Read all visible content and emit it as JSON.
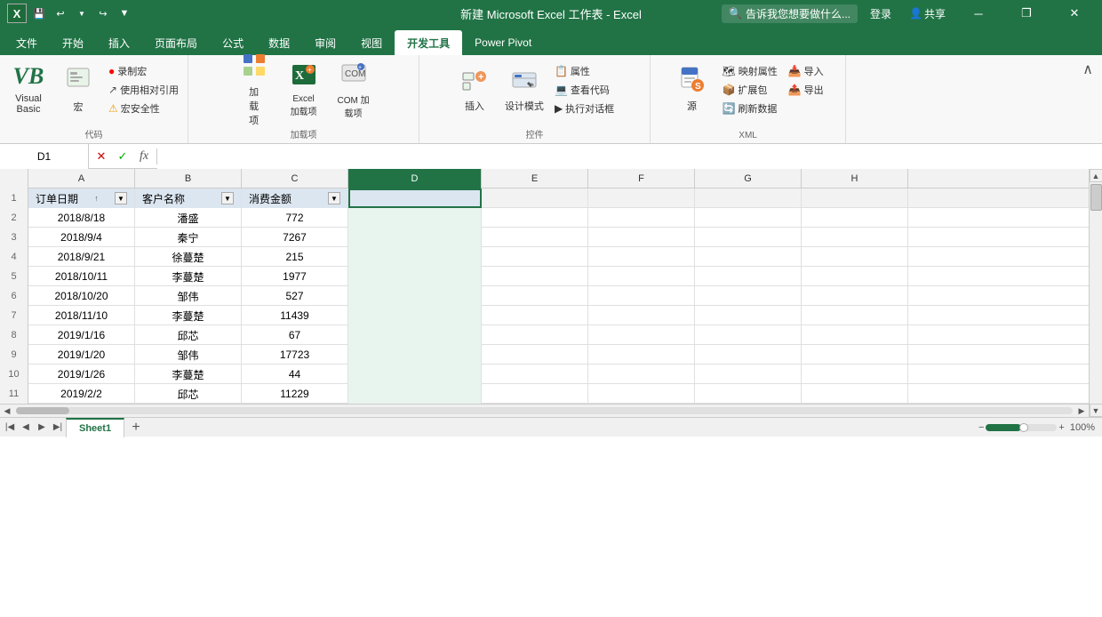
{
  "titleBar": {
    "title": "新建 Microsoft Excel 工作表 - Excel",
    "quickSave": "💾",
    "undo": "↩",
    "redo": "↪",
    "filter": "▼",
    "minimize": "─",
    "maximize": "□",
    "restore": "❐",
    "close": "✕",
    "login": "登录",
    "share": "共享"
  },
  "tabs": [
    {
      "label": "文件",
      "active": false
    },
    {
      "label": "开始",
      "active": false
    },
    {
      "label": "插入",
      "active": false
    },
    {
      "label": "页面布局",
      "active": false
    },
    {
      "label": "公式",
      "active": false
    },
    {
      "label": "数据",
      "active": false
    },
    {
      "label": "审阅",
      "active": false
    },
    {
      "label": "视图",
      "active": false
    },
    {
      "label": "开发工具",
      "active": true
    },
    {
      "label": "Power Pivot",
      "active": false
    }
  ],
  "ribbon": {
    "groups": [
      {
        "id": "code",
        "label": "代码",
        "items": [
          {
            "type": "large",
            "icon": "VB",
            "label": "Visual Basic"
          },
          {
            "type": "large",
            "icon": "M",
            "label": "宏"
          },
          {
            "type": "small",
            "icon": "⏺",
            "label": "录制宏"
          },
          {
            "type": "small",
            "icon": "↗",
            "label": "使用相对引用"
          },
          {
            "type": "small",
            "icon": "⚠",
            "label": "宏安全性"
          }
        ]
      },
      {
        "id": "addins",
        "label": "加载项",
        "items": [
          {
            "type": "large",
            "icon": "➕",
            "label": "加载项"
          },
          {
            "type": "large",
            "icon": "XL",
            "label": "Excel 加载项"
          },
          {
            "type": "large",
            "icon": "COM",
            "label": "COM 加载项"
          }
        ]
      },
      {
        "id": "controls",
        "label": "控件",
        "items": [
          {
            "type": "large",
            "icon": "🔧",
            "label": "插入"
          },
          {
            "type": "large",
            "icon": "✏",
            "label": "设计模式"
          },
          {
            "type": "small",
            "icon": "📋",
            "label": "属性"
          },
          {
            "type": "small",
            "icon": "💻",
            "label": "查看代码"
          },
          {
            "type": "small",
            "icon": "▶",
            "label": "执行对话框"
          }
        ]
      },
      {
        "id": "xml",
        "label": "XML",
        "items": [
          {
            "type": "large",
            "icon": "📄",
            "label": "源"
          },
          {
            "type": "small",
            "icon": "🗺",
            "label": "映射属性"
          },
          {
            "type": "small",
            "icon": "📦",
            "label": "扩展包"
          },
          {
            "type": "small",
            "icon": "🔄",
            "label": "刷新数据"
          },
          {
            "type": "small",
            "icon": "📥",
            "label": "导入"
          },
          {
            "type": "small",
            "icon": "📤",
            "label": "导出"
          }
        ]
      }
    ]
  },
  "formulaBar": {
    "nameBox": "D1",
    "cancelIcon": "✕",
    "confirmIcon": "✓",
    "functionIcon": "fx"
  },
  "columns": [
    {
      "id": "row-num",
      "label": "",
      "class": "row-num-header"
    },
    {
      "id": "A",
      "label": "A",
      "class": "col-a"
    },
    {
      "id": "B",
      "label": "B",
      "class": "col-b"
    },
    {
      "id": "C",
      "label": "C",
      "class": "col-c"
    },
    {
      "id": "D",
      "label": "D",
      "class": "col-d"
    },
    {
      "id": "E",
      "label": "E",
      "class": "col-e"
    },
    {
      "id": "F",
      "label": "F",
      "class": "col-f"
    },
    {
      "id": "G",
      "label": "G",
      "class": "col-g"
    },
    {
      "id": "H",
      "label": "H",
      "class": "col-h"
    }
  ],
  "headerRow": {
    "col_a": "订单日期",
    "col_a_icon": "↑",
    "col_b": "客户名称",
    "col_c": "消费金额",
    "hasFilterA": true,
    "hasFilterB": true,
    "hasFilterC": true
  },
  "rows": [
    {
      "num": 2,
      "a": "2018/8/18",
      "b": "潘盛",
      "c": "772"
    },
    {
      "num": 3,
      "a": "2018/9/4",
      "b": "秦宁",
      "c": "7267"
    },
    {
      "num": 4,
      "a": "2018/9/21",
      "b": "徐蔓楚",
      "c": "215"
    },
    {
      "num": 5,
      "a": "2018/10/11",
      "b": "李蔓楚",
      "c": "1977"
    },
    {
      "num": 6,
      "a": "2018/10/20",
      "b": "邹伟",
      "c": "527"
    },
    {
      "num": 7,
      "a": "2018/11/10",
      "b": "李蔓楚",
      "c": "11439"
    },
    {
      "num": 8,
      "a": "2019/1/16",
      "b": "邱芯",
      "c": "67"
    },
    {
      "num": 9,
      "a": "2019/1/20",
      "b": "邹伟",
      "c": "17723"
    },
    {
      "num": 10,
      "a": "2019/1/26",
      "b": "李蔓楚",
      "c": "44"
    },
    {
      "num": 11,
      "a": "2019/2/2",
      "b": "邱芯",
      "c": "11229"
    }
  ],
  "sheetTabs": [
    {
      "label": "Sheet1",
      "active": true
    }
  ],
  "addSheetLabel": "+",
  "telltip": "告诉我您想要做什么...",
  "colors": {
    "excelGreen": "#217346",
    "ribbonBg": "#f8f8f8",
    "headerBg": "#f2f2f2",
    "gridLine": "#e0e0e0"
  }
}
